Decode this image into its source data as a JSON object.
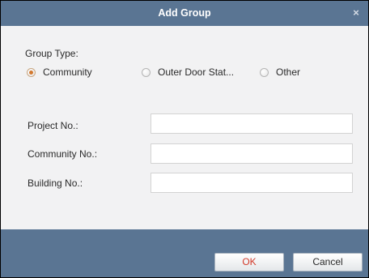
{
  "window": {
    "title": "Add Group",
    "close_symbol": "×"
  },
  "group_type": {
    "label": "Group Type:",
    "options": [
      {
        "label": "Community",
        "selected": true
      },
      {
        "label": "Outer Door Stat...",
        "selected": false
      },
      {
        "label": "Other",
        "selected": false
      }
    ]
  },
  "fields": [
    {
      "label": "Project No.:",
      "value": "",
      "placeholder": ""
    },
    {
      "label": "Community No.:",
      "value": "",
      "placeholder": ""
    },
    {
      "label": "Building No.:",
      "value": "",
      "placeholder": ""
    }
  ],
  "buttons": {
    "ok_label": "OK",
    "cancel_label": "Cancel"
  },
  "colors": {
    "titlebar": "#5a7593",
    "panel": "#f2f2f3",
    "ok_text": "#d23a2a",
    "radio_selected": "#d2792f"
  },
  "icons": {
    "close": "close-icon",
    "radio": "radio-dot-icon"
  }
}
